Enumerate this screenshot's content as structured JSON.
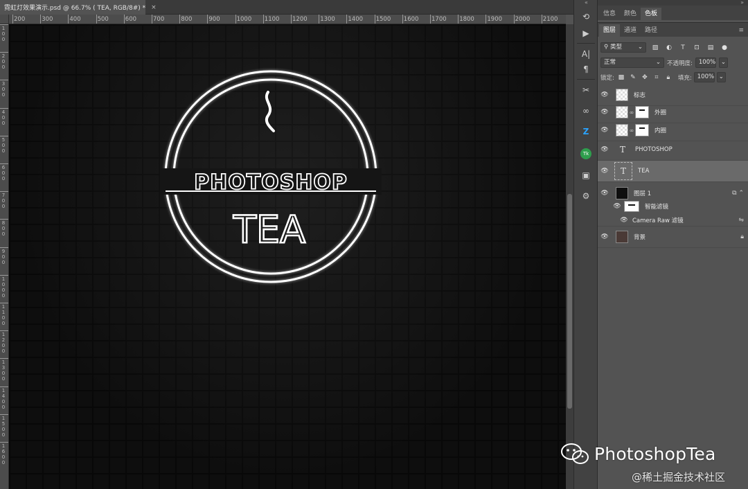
{
  "document_tab": {
    "title": "霓虹灯效果演示.psd @ 66.7% ( TEA, RGB/8#) *",
    "close_glyph": "×"
  },
  "ruler_top": [
    "200",
    "300",
    "400",
    "500",
    "600",
    "700",
    "800",
    "900",
    "1000",
    "1100",
    "1200",
    "1300",
    "1400",
    "1500",
    "1600",
    "1700",
    "1800",
    "1900",
    "2000",
    "2100"
  ],
  "ruler_left": [
    "100",
    "200",
    "300",
    "400",
    "500",
    "600",
    "700",
    "800",
    "900",
    "1000",
    "1100",
    "1200",
    "1300",
    "1400",
    "1500",
    "1600"
  ],
  "canvas_art": {
    "top_word": "PHOTOSHOP",
    "bottom_word": "TEA",
    "neon_color": "#ffffff",
    "wall_color": "#151515"
  },
  "mid_tools": [
    "history-play-icon",
    "character-icon",
    "paragraph-icon",
    "tools-icon",
    "link-icon",
    "z-icon",
    "tk-icon",
    "library-icon",
    "properties-icon"
  ],
  "panel_tabs_top": [
    {
      "label": "信息"
    },
    {
      "label": "颜色"
    },
    {
      "label": "色板"
    }
  ],
  "panel_tabs_layers": [
    {
      "label": "图层"
    },
    {
      "label": "通道"
    },
    {
      "label": "路径"
    }
  ],
  "layers_panel": {
    "filter_kind": "类型",
    "blend_mode": "正常",
    "opacity_label": "不透明度:",
    "opacity_value": "100%",
    "lock_label": "锁定:",
    "fill_label": "填充:",
    "fill_value": "100%",
    "layers": [
      {
        "name": "标志"
      },
      {
        "name": "外圈"
      },
      {
        "name": "内圈"
      },
      {
        "name": "PHOTOSHOP"
      },
      {
        "name": "TEA"
      },
      {
        "name": "图层 1"
      },
      {
        "name": "智能滤镜"
      },
      {
        "name": "Camera Raw 滤镜"
      },
      {
        "name": "背景"
      }
    ]
  },
  "watermark": {
    "brand": "PhotoshopTea",
    "sub": "@稀土掘金技术社区"
  }
}
